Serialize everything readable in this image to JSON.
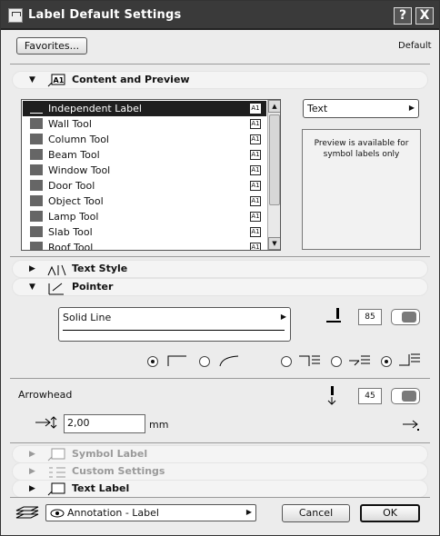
{
  "window": {
    "title": "Label Default Settings",
    "help_label": "?",
    "close_label": "X"
  },
  "top": {
    "favorites_label": "Favorites...",
    "default_label": "Default"
  },
  "sections": {
    "content": "Content and Preview",
    "text_style": "Text Style",
    "pointer": "Pointer",
    "symbol_label": "Symbol Label",
    "custom_settings": "Custom Settings",
    "text_label": "Text Label"
  },
  "section_icon_text": "A1",
  "tools": [
    {
      "name": "Independent Label",
      "icon": "label-icon",
      "selected": true
    },
    {
      "name": "Wall Tool",
      "icon": "wall-icon"
    },
    {
      "name": "Column Tool",
      "icon": "column-icon"
    },
    {
      "name": "Beam Tool",
      "icon": "beam-icon"
    },
    {
      "name": "Window Tool",
      "icon": "window-icon"
    },
    {
      "name": "Door Tool",
      "icon": "door-icon"
    },
    {
      "name": "Object Tool",
      "icon": "object-icon"
    },
    {
      "name": "Lamp Tool",
      "icon": "lamp-icon"
    },
    {
      "name": "Slab Tool",
      "icon": "slab-icon"
    },
    {
      "name": "Roof Tool",
      "icon": "roof-icon"
    }
  ],
  "tool_checkbox_text": "A1",
  "content": {
    "type_select": "Text",
    "preview_note": "Preview is available for symbol labels only"
  },
  "pointer": {
    "line_type": "Solid Line",
    "pen_value": "85",
    "arrowhead_label": "Arrowhead",
    "arrow_pen_value": "45",
    "size_value": "2,00",
    "size_unit": "mm"
  },
  "bottom": {
    "layer_value": "Annotation - Label",
    "cancel_label": "Cancel",
    "ok_label": "OK"
  }
}
